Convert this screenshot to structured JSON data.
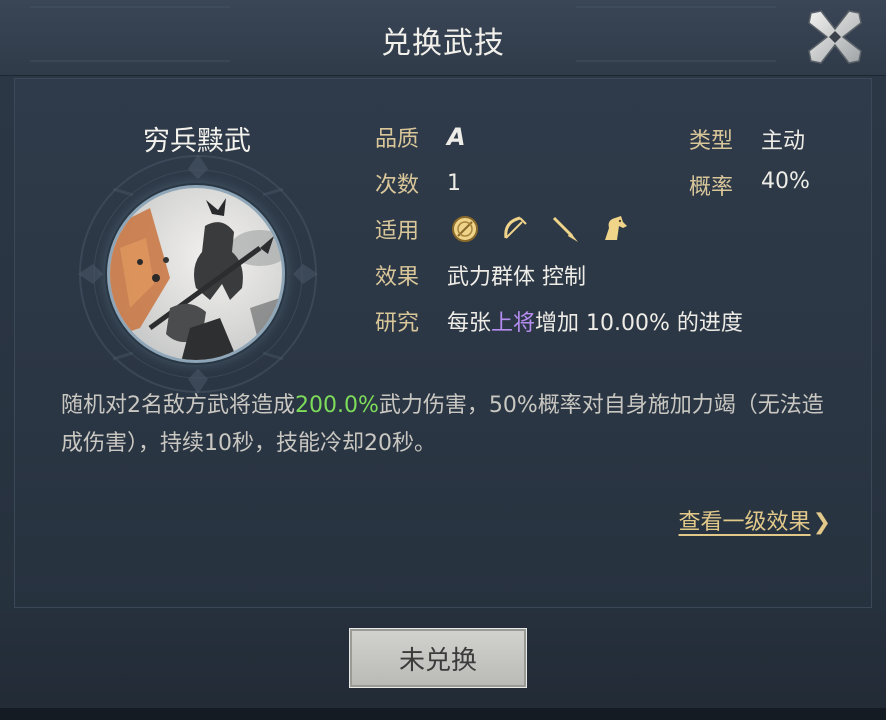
{
  "dialog": {
    "title": "兑换武技",
    "close_icon": "close-x-icon"
  },
  "skill": {
    "name": "穷兵黩武",
    "portrait": "warrior-portrait-icon",
    "quality_label": "品质",
    "quality_value": "A",
    "type_label": "类型",
    "type_value": "主动",
    "count_label": "次数",
    "count_value": "1",
    "chance_label": "概率",
    "chance_value": "40%",
    "applies_label": "适用",
    "applies_icons": [
      "shield-icon",
      "bow-icon",
      "spear-icon",
      "horse-icon"
    ],
    "effect_label": "效果",
    "effect_value": "武力群体 控制",
    "research_label": "研究",
    "research_prefix": "每张",
    "research_highlight": "上将",
    "research_suffix": "增加 10.00% 的进度"
  },
  "description": {
    "part1": "随机对2名敌方武将造成",
    "highlight": "200.0%",
    "part2": "武力伤害，50%概率对自身施加力竭（无法造成伤害），持续10秒，技能冷却20秒。"
  },
  "links": {
    "view_level1": "查看一级效果",
    "arrow": "❯"
  },
  "footer": {
    "button_label": "未兑换"
  },
  "colors": {
    "label_gold": "#d9c79a",
    "highlight_green": "#7ddc5a",
    "highlight_purple": "#b68df0",
    "link_gold": "#e2c98a"
  }
}
